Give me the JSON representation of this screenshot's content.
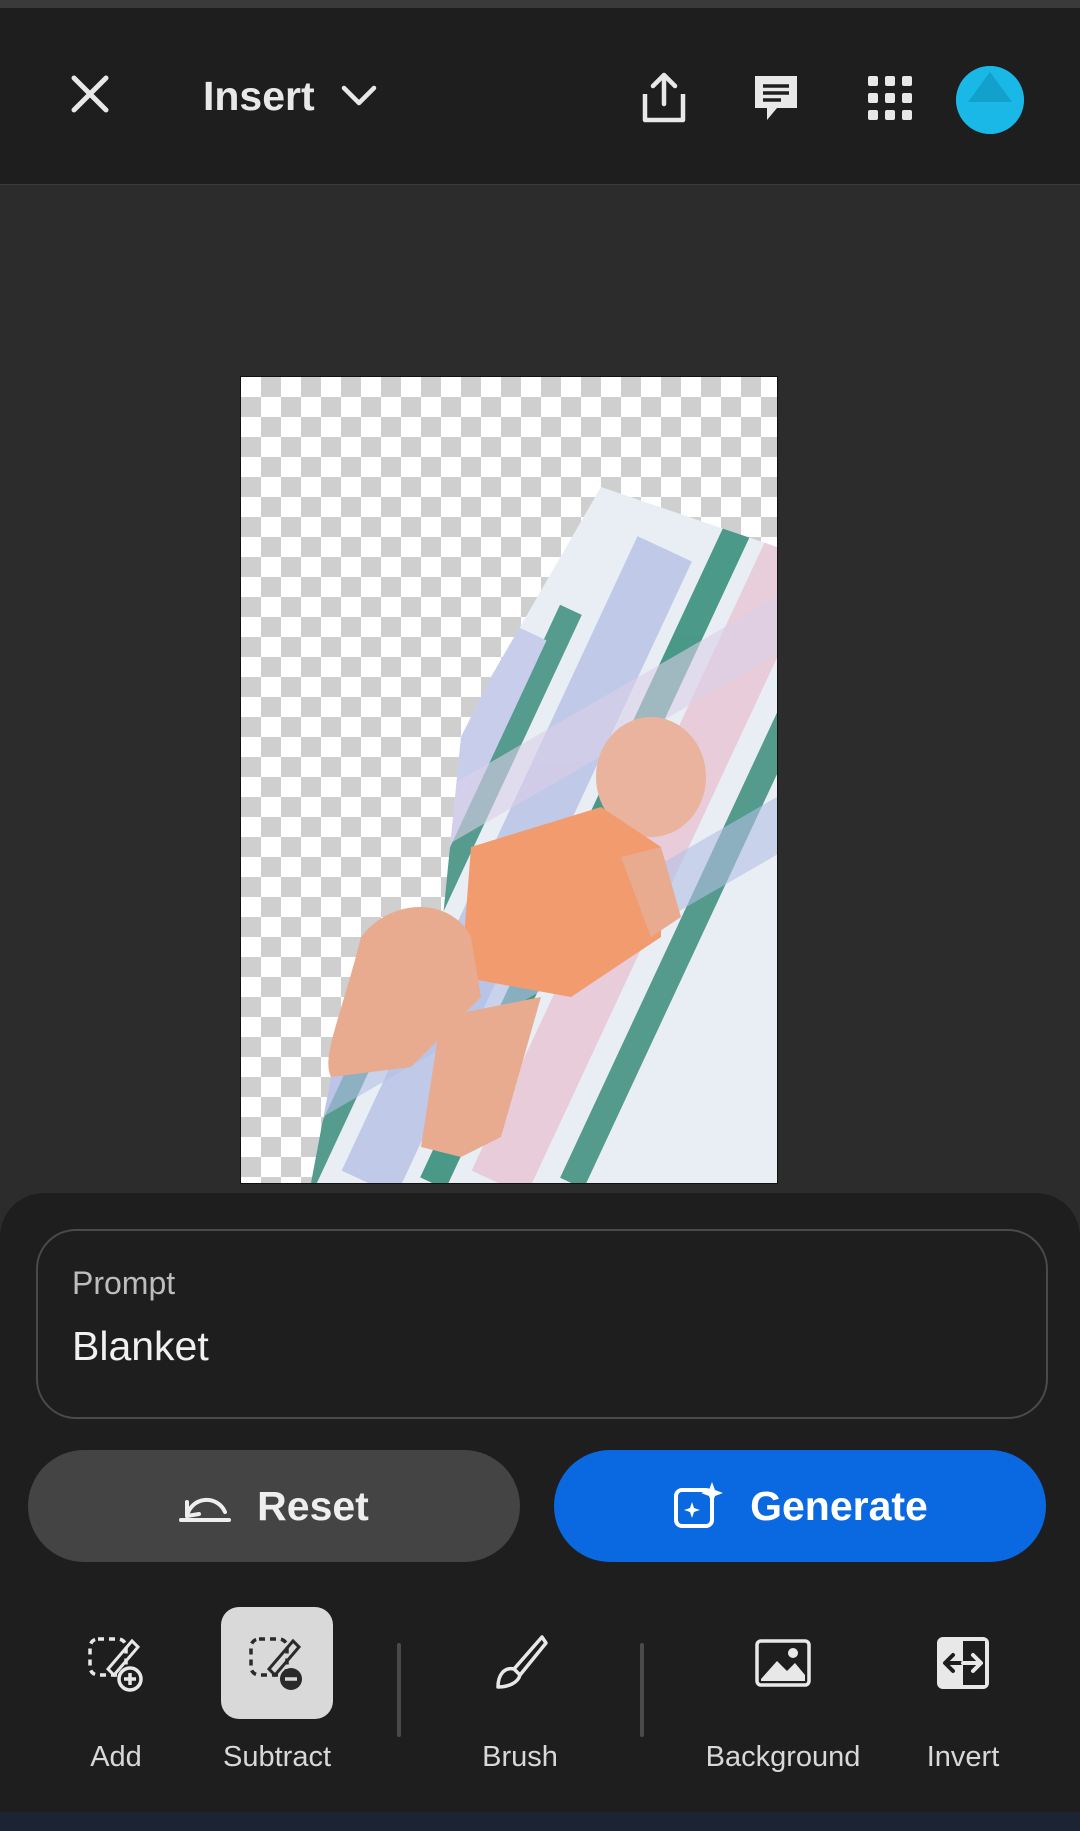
{
  "header": {
    "mode_label": "Insert",
    "close_icon": "close-icon",
    "share_icon": "share-icon",
    "comment_icon": "comment-icon",
    "apps_icon": "apps-grid-icon",
    "avatar_color": "#19b8e6"
  },
  "canvas": {
    "image_description_icon": "photo-baby-on-blanket"
  },
  "prompt": {
    "label": "Prompt",
    "value": "Blanket"
  },
  "actions": {
    "reset_label": "Reset",
    "generate_label": "Generate",
    "generate_color": "#0a68e0"
  },
  "tools": [
    {
      "label": "Add",
      "icon": "add-selection-icon",
      "active": false
    },
    {
      "label": "Subtract",
      "icon": "subtract-selection-icon",
      "active": true
    },
    {
      "label": "Brush",
      "icon": "brush-icon",
      "active": false
    },
    {
      "label": "Background",
      "icon": "background-image-icon",
      "active": false
    },
    {
      "label": "Invert",
      "icon": "invert-icon",
      "active": false
    }
  ]
}
